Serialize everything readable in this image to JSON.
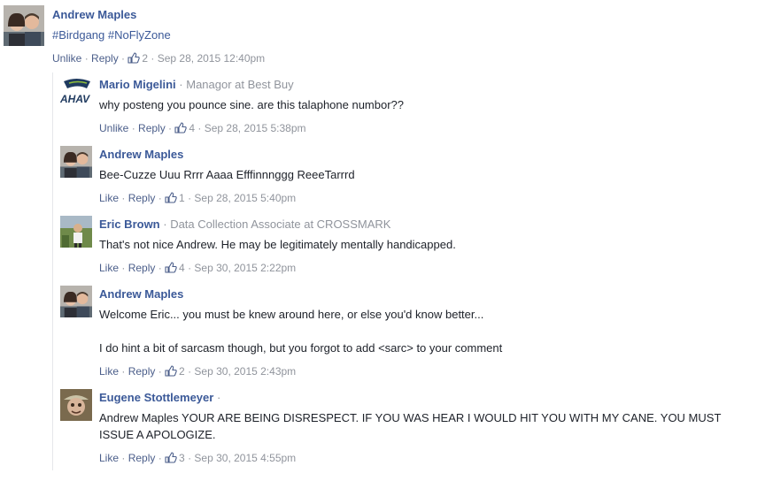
{
  "top_comment": {
    "author": "Andrew Maples",
    "text": "#Birdgang #NoFlyZone",
    "action": "Unlike",
    "reply": "Reply",
    "likes": "2",
    "timestamp": "Sep 28, 2015 12:40pm"
  },
  "replies": [
    {
      "author": "Mario Migelini",
      "job": "Managor at Best Buy",
      "lines": [
        "why posteng you pounce sine. are this talaphone numbor??"
      ],
      "action": "Unlike",
      "reply": "Reply",
      "likes": "4",
      "timestamp": "Sep 28, 2015 5:38pm"
    },
    {
      "author": "Andrew Maples",
      "job": "",
      "lines": [
        "Bee-Cuzze Uuu Rrrr Aaaa Efffinnnggg ReeeTarrrd"
      ],
      "action": "Like",
      "reply": "Reply",
      "likes": "1",
      "timestamp": "Sep 28, 2015 5:40pm"
    },
    {
      "author": "Eric Brown",
      "job": "Data Collection Associate at CROSSMARK",
      "lines": [
        "That's not nice Andrew. He may be legitimately mentally handicapped."
      ],
      "action": "Like",
      "reply": "Reply",
      "likes": "4",
      "timestamp": "Sep 30, 2015 2:22pm"
    },
    {
      "author": "Andrew Maples",
      "job": "",
      "lines": [
        "Welcome Eric... you must be knew around here, or else you'd know better...",
        "I do hint a bit of sarcasm though, but you forgot to add <sarc> to your comment"
      ],
      "action": "Like",
      "reply": "Reply",
      "likes": "2",
      "timestamp": "Sep 30, 2015 2:43pm"
    },
    {
      "author": "Eugene Stottlemeyer",
      "job": "",
      "lines": [
        "Andrew Maples YOUR ARE BEING DISRESPECT. IF YOU WAS HEAR I WOULD HIT YOU WITH MY CANE. YOU MUST",
        "ISSUE A APOLOGIZE."
      ],
      "action": "Like",
      "reply": "Reply",
      "likes": "3",
      "timestamp": "Sep 30, 2015 4:55pm"
    }
  ],
  "logo_text": "AHAV",
  "colors": {
    "link": "#3b5998",
    "meta": "#90949c",
    "action": "#4b5e8a"
  }
}
